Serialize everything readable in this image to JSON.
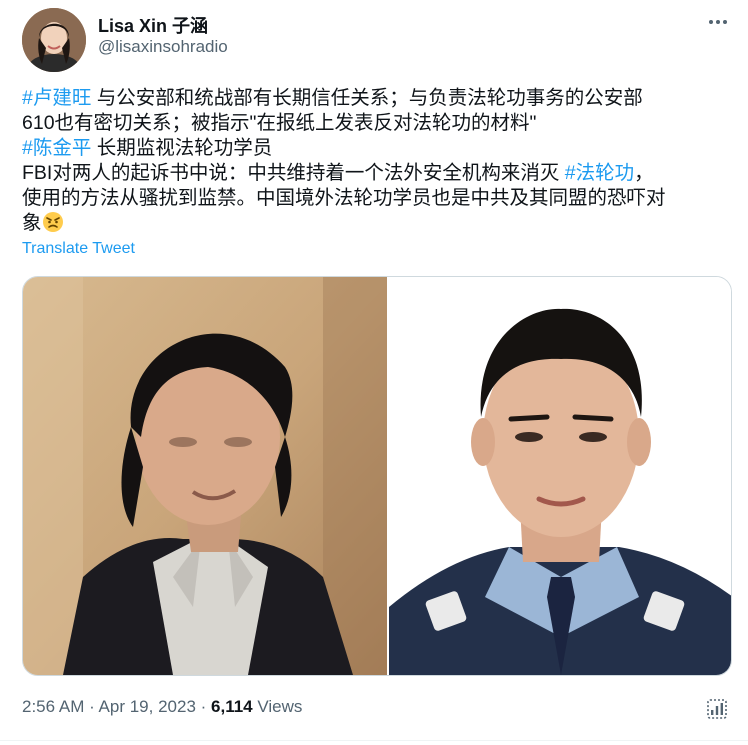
{
  "author": {
    "name": "Lisa Xin 子涵",
    "handle": "@lisaxinsohradio"
  },
  "tweet": {
    "line1": {
      "hashtag": "#卢建旺",
      "text": " 与公安部和统战部有长期信任关系；与负责法轮功事务的公安部"
    },
    "line2": {
      "text": "610也有密切关系；被指示\"在报纸上发表反对法轮功的材料\""
    },
    "line3": {
      "hashtag": "#陈金平",
      "text": " 长期监视法轮功学员"
    },
    "line4": {
      "text_before": "FBI对两人的起诉书中说：中共维持着一个法外安全机构来消灭 ",
      "hashtag": "#法轮功",
      "text_after": "，"
    },
    "line5": {
      "text": "使用的方法从骚扰到监禁。中国境外法轮功学员也是中共及其同盟的恐吓对"
    },
    "line6": {
      "text": "象",
      "emoji": "angry-face-emoji"
    },
    "translate_label": "Translate Tweet"
  },
  "media": {
    "left_photo": "man-in-dark-jacket-photo",
    "right_photo": "police-officer-portrait-photo"
  },
  "meta": {
    "time": "2:56 AM",
    "separator": " · ",
    "date": "Apr 19, 2023",
    "views_count": "6,114",
    "views_label": " Views"
  },
  "icons": {
    "more": "more-icon",
    "analytics": "analytics-icon"
  },
  "colors": {
    "accent": "#1d9bf0",
    "text": "#0f1419",
    "secondary": "#536471",
    "border": "#cfd9de"
  }
}
